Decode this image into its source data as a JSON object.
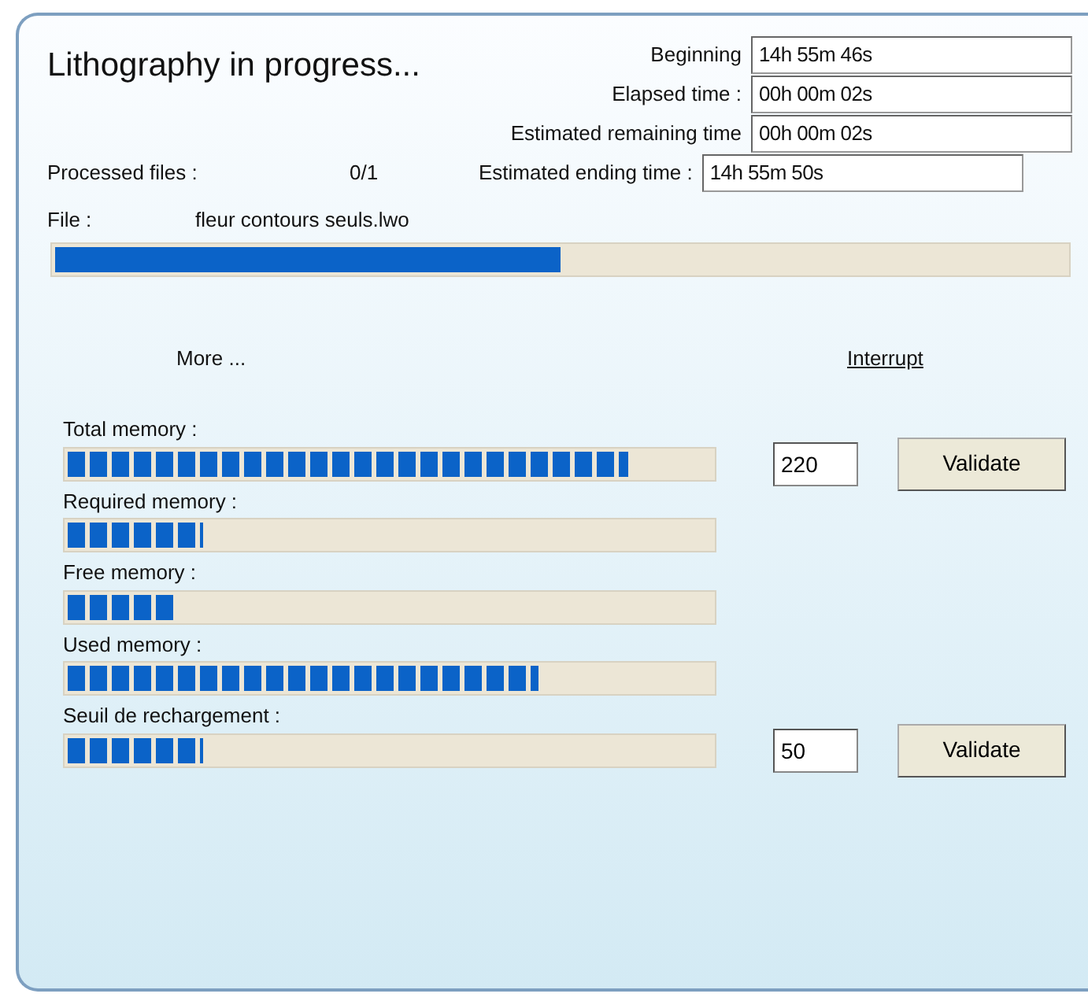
{
  "title": "Lithography in progress...",
  "times": [
    {
      "label": "Beginning",
      "value": "14h 55m 46s"
    },
    {
      "label": "Elapsed time :",
      "value": "00h 00m 02s"
    },
    {
      "label": "Estimated remaining time",
      "value": "00h 00m 02s"
    },
    {
      "label": "Estimated ending time :",
      "value": "14h 55m 50s"
    }
  ],
  "processed": {
    "label": "Processed files :",
    "value": "0/1"
  },
  "file": {
    "label": "File :",
    "name": "fleur contours seuls.lwo",
    "level": 0.5
  },
  "more_link": "More ...",
  "interrupt_link": "Interrupt",
  "memory": [
    {
      "label": "Total memory :",
      "level": 0.87,
      "input_value": "220",
      "button": "Validate"
    },
    {
      "label": "Required memory :",
      "level": 0.21
    },
    {
      "label": "Free memory :",
      "level": 0.17
    },
    {
      "label": "Used memory :",
      "level": 0.73
    },
    {
      "label": "Seuil de rechargement :",
      "level": 0.21,
      "input_value": "50",
      "button": "Validate"
    }
  ]
}
